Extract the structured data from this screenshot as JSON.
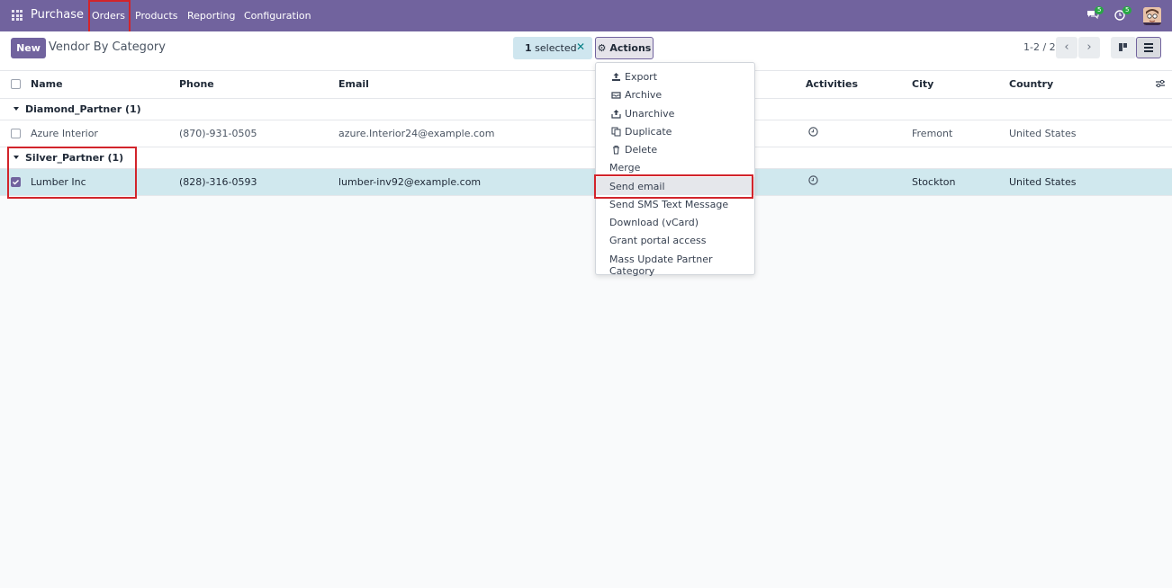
{
  "navbar": {
    "brand": "Purchase",
    "menu": [
      "Orders",
      "Products",
      "Reporting",
      "Configuration"
    ],
    "messages_count": "5",
    "activities_count": "5"
  },
  "control": {
    "new_label": "New",
    "title": "Vendor By Category",
    "selected_count": "1",
    "selected_label": "selected",
    "actions_label": "Actions",
    "pager": "1-2 / 2"
  },
  "table": {
    "columns": [
      "Name",
      "Phone",
      "Email",
      "Activities",
      "City",
      "Country"
    ],
    "groups": [
      {
        "label": "Diamond_Partner (1)",
        "rows": [
          {
            "name": "Azure Interior",
            "phone": "(870)-931-0505",
            "email": "azure.Interior24@example.com",
            "city": "Fremont",
            "country": "United States",
            "selected": false
          }
        ]
      },
      {
        "label": "Silver_Partner (1)",
        "rows": [
          {
            "name": "Lumber Inc",
            "phone": "(828)-316-0593",
            "email": "lumber-inv92@example.com",
            "city": "Stockton",
            "country": "United States",
            "selected": true
          }
        ]
      }
    ]
  },
  "actions_menu": {
    "items": [
      {
        "label": "Export",
        "icon": "export-icon"
      },
      {
        "label": "Archive",
        "icon": "archive-icon"
      },
      {
        "label": "Unarchive",
        "icon": "unarchive-icon"
      },
      {
        "label": "Duplicate",
        "icon": "duplicate-icon"
      },
      {
        "label": "Delete",
        "icon": "trash-icon"
      },
      {
        "label": "Merge",
        "icon": ""
      },
      {
        "label": "Send email",
        "icon": ""
      },
      {
        "label": "Send SMS Text Message",
        "icon": ""
      },
      {
        "label": "Download (vCard)",
        "icon": ""
      },
      {
        "label": "Grant portal access",
        "icon": ""
      },
      {
        "label": "Mass Update Partner Category",
        "icon": ""
      }
    ],
    "highlighted": "Send email"
  },
  "colors": {
    "brand": "#71639e",
    "annotation": "#d2242b",
    "selected_row": "#d0e8ee"
  }
}
